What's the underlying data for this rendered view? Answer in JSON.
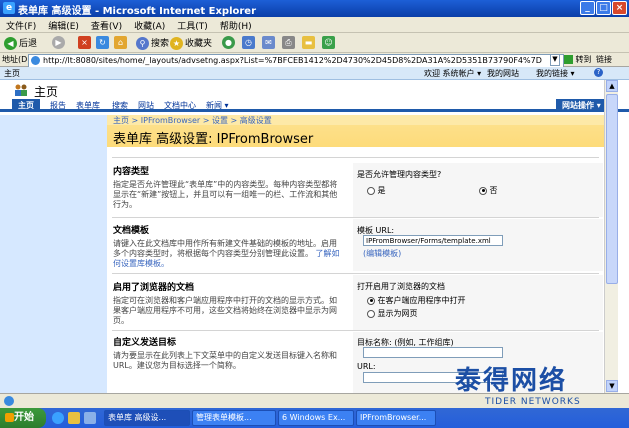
{
  "window": {
    "title": "表单库 高级设置 - Microsoft Internet Explorer"
  },
  "menu": [
    "文件(F)",
    "编辑(E)",
    "查看(V)",
    "收藏(A)",
    "工具(T)",
    "帮助(H)"
  ],
  "toolbar": {
    "back": "后退",
    "search": "搜索",
    "favorites": "收藏夹"
  },
  "address": {
    "label": "地址(D)",
    "url": "http://lt:8080/sites/home/_layouts/advsetng.aspx?List=%7BFCEB1412%2D4730%2D45D8%2DA31A%2D5351B73790F4%7D",
    "go": "转到",
    "links": "链接"
  },
  "sp": {
    "top_left": "主页",
    "welcome": "欢迎 系统帐户 ▾",
    "my_site": "我的网站",
    "my_links": "我的链接 ▾",
    "site_title": "主页",
    "tabs": [
      "主页",
      "报告",
      "表单库",
      "搜索",
      "网站",
      "文档中心",
      "新闻 ▾"
    ],
    "site_actions": "网站操作 ▾",
    "breadcrumb": "主页 > IPFromBrowser > 设置 > 高级设置",
    "page_title": "表单库 高级设置: IPFromBrowser"
  },
  "sections": {
    "content_types": {
      "title": "内容类型",
      "desc": "指定是否允许管理此“表单库”中的内容类型。每种内容类型都将显示在“新建”按钮上，并且可以有一组唯一的栏、工作流和其他行为。",
      "question": "是否允许管理内容类型?",
      "yes": "是",
      "no": "否"
    },
    "doc_template": {
      "title": "文档模板",
      "desc": "请键入在此文档库中用作所有新建文件基础的模板的地址。启用多个内容类型时，将根据每个内容类型分别管理此设置。",
      "learn_more": "了解如何设置库模板。",
      "url_label": "模板 URL:",
      "url_value": "IPFromBrowser/Forms/template.xml",
      "edit_link": "(编辑模板)"
    },
    "browser_docs": {
      "title": "启用了浏览器的文档",
      "desc": "指定可在浏览器和客户端应用程序中打开的文档的显示方式。如果客户端应用程序不可用，这些文档将始终在浏览器中显示为网页。",
      "question": "打开启用了浏览器的文档",
      "opt_client": "在客户端应用程序中打开",
      "opt_web": "显示为网页"
    },
    "send_to": {
      "title": "自定义发送目标",
      "desc": "请为要显示在此列表上下文菜单中的自定义发送目标键入名称和 URL。建议您为目标选择一个简称。",
      "name_label": "目标名称: (例如, 工作组库)",
      "url_label": "URL:"
    }
  },
  "taskbar": {
    "start": "开始",
    "items": [
      "表单库 高级设...",
      "管理表单模板...",
      "6 Windows Ex...",
      "IPFromBrowser..."
    ]
  },
  "watermark": {
    "cn": "泰得网络",
    "en": "TIDER NETWORKS"
  }
}
